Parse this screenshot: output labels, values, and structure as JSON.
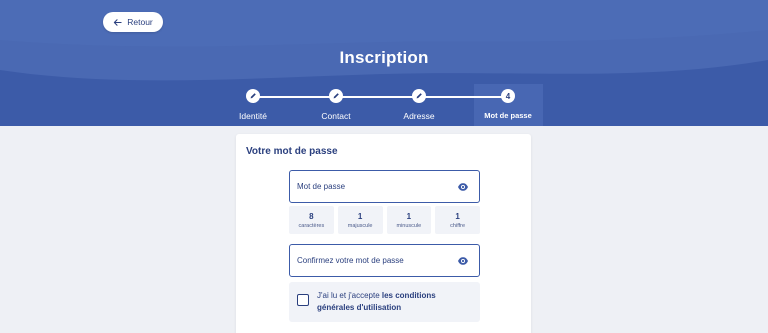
{
  "header": {
    "back_label": "Retour",
    "title": "Inscription"
  },
  "steps": [
    {
      "label": "Identité",
      "state": "done"
    },
    {
      "label": "Contact",
      "state": "done"
    },
    {
      "label": "Adresse",
      "state": "done"
    },
    {
      "label": "Mot de passe",
      "state": "active",
      "number": "4"
    }
  ],
  "form": {
    "section_title": "Votre mot de passe",
    "password_placeholder": "Mot de passe",
    "confirm_placeholder": "Confirmez votre mot de passe",
    "rules": [
      {
        "value": "8",
        "label": "caractères"
      },
      {
        "value": "1",
        "label": "majuscule"
      },
      {
        "value": "1",
        "label": "minuscule"
      },
      {
        "value": "1",
        "label": "chiffre"
      }
    ],
    "cgu_prefix": "J'ai lu et j'accepte ",
    "cgu_link": "les conditions générales d'utilisation"
  },
  "colors": {
    "brand": "#3c5ba8",
    "text": "#2a3f7e",
    "background": "#eef0f5"
  }
}
